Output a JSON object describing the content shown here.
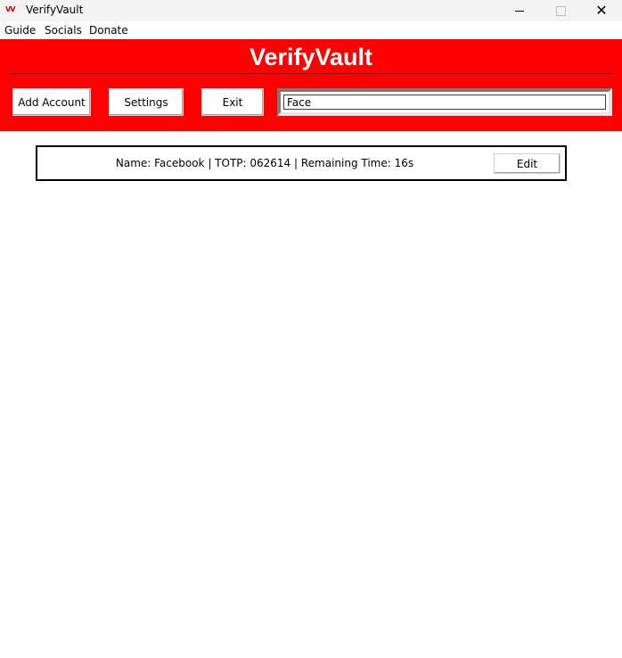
{
  "window": {
    "icon_text": "VV",
    "title": "VerifyVault",
    "minimize_icon": "minimize-icon",
    "maximize_icon": "maximize-icon",
    "close_symbol": "✕"
  },
  "menu": {
    "items": [
      "Guide",
      "Socials",
      "Donate"
    ]
  },
  "header": {
    "title": "VerifyVault",
    "background_color": "#ff0000",
    "buttons": {
      "add_account": "Add Account",
      "settings": "Settings",
      "exit": "Exit"
    },
    "search": {
      "value": "Face"
    }
  },
  "results": [
    {
      "text": "Name: Facebook | TOTP: 062614 | Remaining Time: 16s",
      "edit_label": "Edit"
    }
  ]
}
